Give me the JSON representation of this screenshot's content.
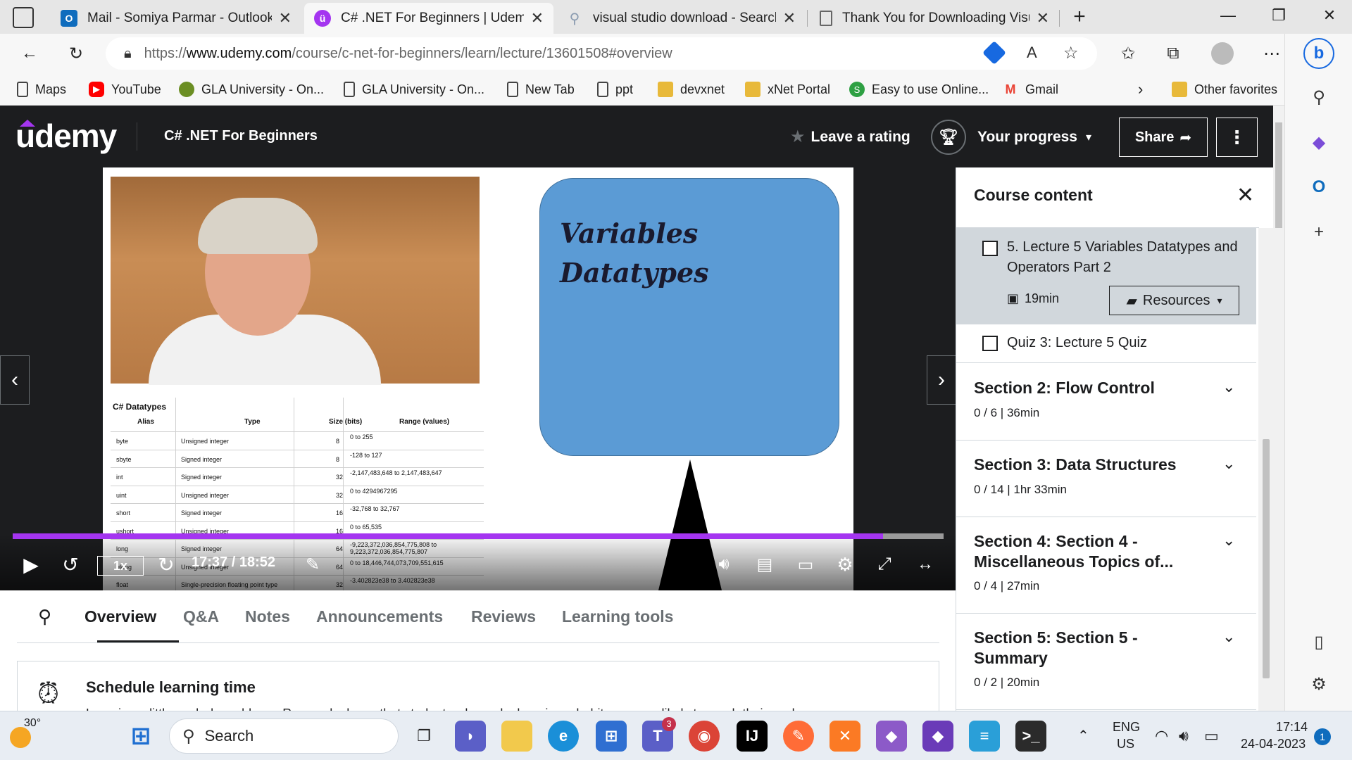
{
  "browser": {
    "tabs": [
      {
        "title": "Mail - Somiya Parmar - Outlook",
        "icon": "outlook-icon",
        "color": "#0f6cbd",
        "active": false
      },
      {
        "title": "C# .NET For Beginners | Udemy",
        "icon": "udemy-icon",
        "color": "#a435f0",
        "active": true
      },
      {
        "title": "visual studio download - Search",
        "icon": "search-icon",
        "color": "#8a9bb0",
        "active": false
      },
      {
        "title": "Thank You for Downloading Visu",
        "icon": "page-icon",
        "color": "#888888",
        "active": false
      }
    ],
    "url": {
      "prefix": "https://",
      "host": "www.udemy.com",
      "path": "/course/c-net-for-beginners/learn/lecture/13601508#overview"
    },
    "bookmarks": [
      {
        "label": "Maps",
        "icon": "page-icon"
      },
      {
        "label": "YouTube",
        "icon": "youtube-icon"
      },
      {
        "label": "GLA University - On...",
        "icon": "gla-icon"
      },
      {
        "label": "GLA University - On...",
        "icon": "page-icon"
      },
      {
        "label": "New Tab",
        "icon": "page-icon"
      },
      {
        "label": "ppt",
        "icon": "page-icon"
      },
      {
        "label": "devxnet",
        "icon": "devxnet-icon"
      },
      {
        "label": "xNet Portal",
        "icon": "xnet-icon"
      },
      {
        "label": "Easy to use Online...",
        "icon": "easy-icon"
      },
      {
        "label": "Gmail",
        "icon": "gmail-icon"
      }
    ],
    "other_favorites": "Other favorites"
  },
  "udemy": {
    "logo": "udemy",
    "course_title": "C# .NET For Beginners",
    "leave_rating": "Leave a rating",
    "your_progress": "Your progress",
    "share": "Share",
    "accent_color": "#a435f0"
  },
  "video": {
    "slide_title_line1": "Variables",
    "slide_title_line2": "Datatypes",
    "table": {
      "caption": "C# Datatypes",
      "headers": [
        "Alias",
        "Type",
        "Size (bits)",
        "Range (values)"
      ],
      "rows": [
        [
          "byte",
          "Unsigned integer",
          "8",
          "0 to 255"
        ],
        [
          "sbyte",
          "Signed integer",
          "8",
          "-128 to 127"
        ],
        [
          "int",
          "Signed integer",
          "32",
          "-2,147,483,648 to 2,147,483,647"
        ],
        [
          "uint",
          "Unsigned integer",
          "32",
          "0 to 4294967295"
        ],
        [
          "short",
          "Signed integer",
          "16",
          "-32,768 to 32,767"
        ],
        [
          "ushort",
          "Unsigned integer",
          "16",
          "0 to 65,535"
        ],
        [
          "long",
          "Signed integer",
          "64",
          "-9,223,372,036,854,775,808 to 9,223,372,036,854,775,807"
        ],
        [
          "ulong",
          "Unsigned integer",
          "64",
          "0 to 18,446,744,073,709,551,615"
        ],
        [
          "float",
          "Single-precision floating point type",
          "32",
          "-3.402823e38 to 3.402823e38"
        ]
      ]
    },
    "speed": "1x",
    "time": "17:37 / 18:52",
    "progress_fraction": 0.935
  },
  "subtabs": [
    "Overview",
    "Q&A",
    "Notes",
    "Announcements",
    "Reviews",
    "Learning tools"
  ],
  "schedule": {
    "title": "Schedule learning time",
    "desc": "Learning a little each day adds up. Research shows that students who make learning a habit are more likely to reach their goals."
  },
  "course_content": {
    "title": "Course content",
    "lecture": {
      "title": "5. Lecture 5 Variables Datatypes and Operators Part 2",
      "duration": "19min",
      "resources": "Resources"
    },
    "quiz": "Quiz 3: Lecture 5 Quiz",
    "sections": [
      {
        "title": "Section 2: Flow Control",
        "sub": "0 / 6 | 36min"
      },
      {
        "title": "Section 3: Data Structures",
        "sub": "0 / 14 | 1hr 33min"
      },
      {
        "title": "Section 4: Section 4 - Miscellaneous Topics of...",
        "sub": "0 / 4 | 27min"
      },
      {
        "title": "Section 5: Section 5 - Summary",
        "sub": "0 / 2 | 20min"
      }
    ]
  },
  "taskbar": {
    "weather": "30°",
    "search": "Search",
    "lang1": "ENG",
    "lang2": "US",
    "time": "17:14",
    "date": "24-04-2023",
    "notif_count": "1",
    "teams_badge": "3"
  }
}
